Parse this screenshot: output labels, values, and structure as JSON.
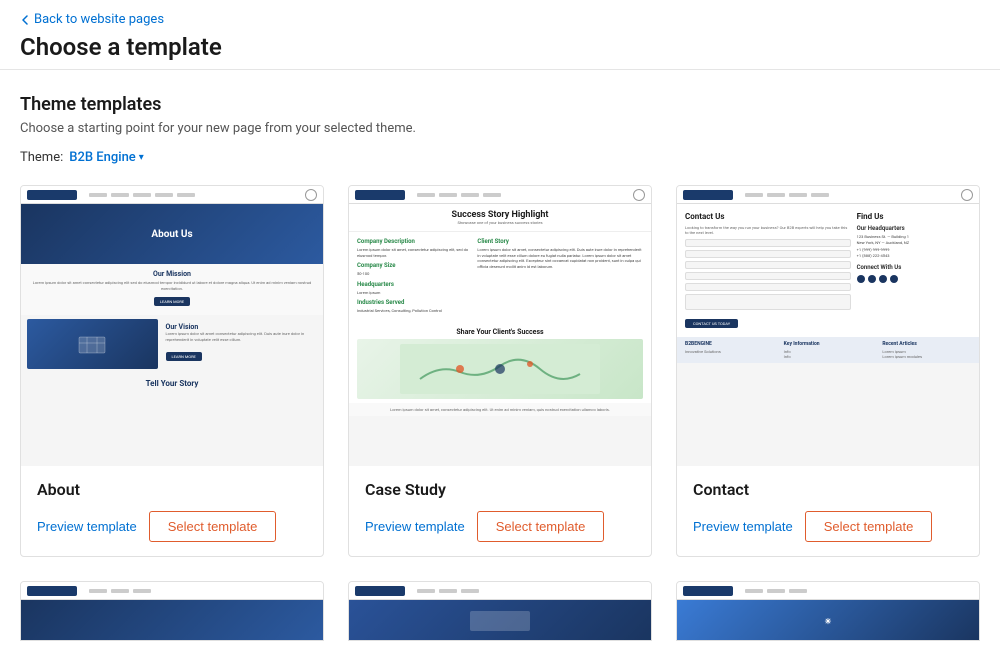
{
  "header": {
    "back_link": "Back to website pages",
    "page_title": "Choose a template"
  },
  "section": {
    "title": "Theme templates",
    "description": "Choose a starting point for your new page from your selected theme.",
    "theme_label": "Theme:",
    "theme_value": "B2B Engine"
  },
  "templates": [
    {
      "id": "about",
      "name": "About",
      "preview_label": "Preview template",
      "select_label": "Select template"
    },
    {
      "id": "case-study",
      "name": "Case Study",
      "preview_label": "Preview template",
      "select_label": "Select template"
    },
    {
      "id": "contact",
      "name": "Contact",
      "preview_label": "Preview template",
      "select_label": "Select template"
    }
  ],
  "bottom_templates": [
    {
      "id": "bottom-1"
    },
    {
      "id": "bottom-2"
    },
    {
      "id": "bottom-3"
    }
  ]
}
